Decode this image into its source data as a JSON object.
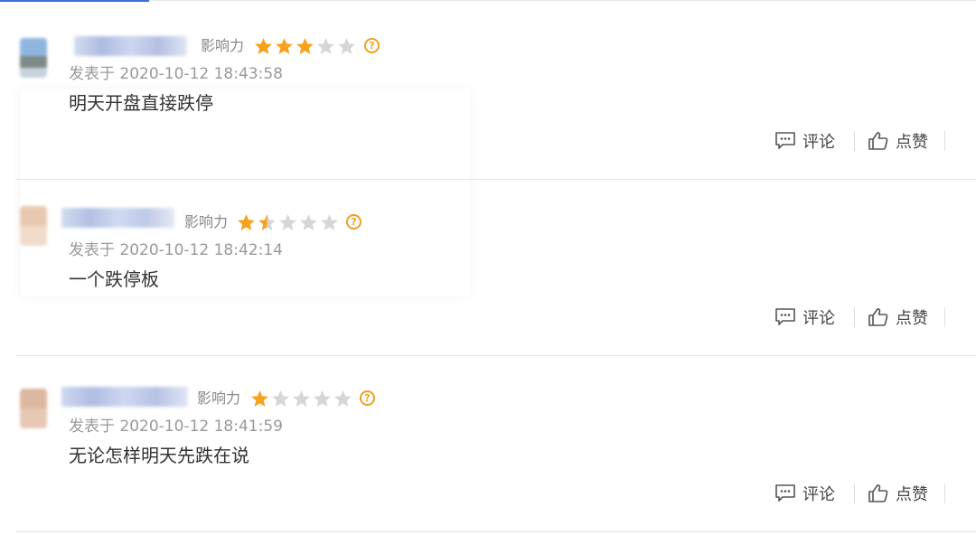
{
  "comments": [
    {
      "influence_label": "影响力",
      "rating": 3,
      "time": "发表于 2020-10-12 18:43:58",
      "content": "明天开盘直接跌停",
      "comment_label": "评论",
      "like_label": "点赞"
    },
    {
      "influence_label": "影响力",
      "rating": 1.5,
      "time": "发表于 2020-10-12 18:42:14",
      "content": "一个跌停板",
      "comment_label": "评论",
      "like_label": "点赞"
    },
    {
      "influence_label": "影响力",
      "rating": 1,
      "time": "发表于 2020-10-12 18:41:59",
      "content": "无论怎样明天先跌在说",
      "comment_label": "评论",
      "like_label": "点赞"
    }
  ],
  "help_symbol": "?",
  "colors": {
    "star_filled": "#f7a21b",
    "star_empty": "#d6d6d6",
    "accent": "#3b6fd6",
    "help": "#f0a020"
  },
  "icons": {
    "comment": "speech-bubble-icon",
    "like": "thumbs-up-icon",
    "help": "question-circle-icon",
    "star": "star-icon"
  }
}
